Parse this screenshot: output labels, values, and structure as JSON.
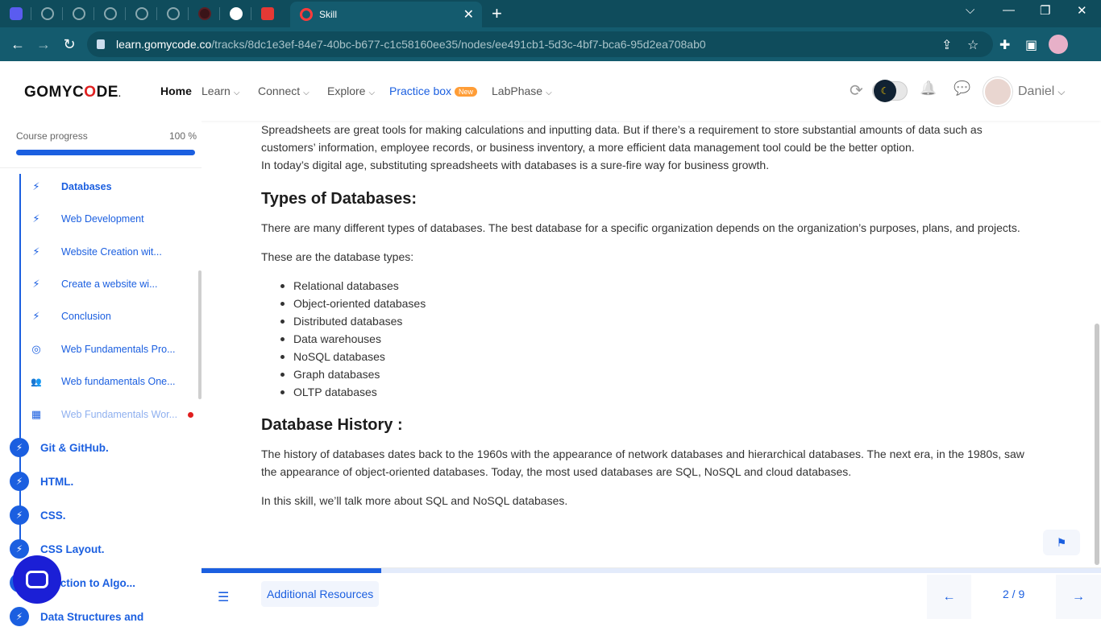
{
  "browser": {
    "active_tab_title": "Skill",
    "close_glyph": "✕",
    "new_tab_glyph": "+",
    "url_host": "learn.gomycode.co",
    "url_path": "/tracks/8dc1e3ef-84e7-40bc-b677-c1c58160ee35/nodes/ee491cb1-5d3c-4bf7-bca6-95d2ea708ab0",
    "back_glyph": "←",
    "forward_glyph": "→",
    "reload_glyph": "↻",
    "minimize_glyph": "—",
    "restore_glyph": "❐",
    "close_window_glyph": "✕",
    "share_glyph": "⇪",
    "star_glyph": "☆",
    "extensions_glyph": "✚",
    "sidepanel_glyph": "▣"
  },
  "header": {
    "logo_pre": "GOMYC",
    "logo_o": "O",
    "logo_post": "DE",
    "logo_mark": ".",
    "nav": {
      "home": "Home",
      "learn": "Learn",
      "connect": "Connect",
      "explore": "Explore",
      "practice": "Practice box",
      "practice_badge": "New",
      "labphase": "LabPhase"
    },
    "chevron": "⌵",
    "sync_glyph": "⟳",
    "moon_glyph": "☾",
    "bell_glyph": "🔔",
    "chat_glyph": "💬",
    "user_name": "Daniel"
  },
  "sidebar": {
    "progress_label": "Course progress",
    "progress_value": "100 %",
    "progress_fraction": 1.0,
    "items": [
      {
        "label": "Databases",
        "icon": "bolt-icon",
        "glyph": "⚡"
      },
      {
        "label": "Web Development",
        "icon": "bolt-icon",
        "glyph": "⚡"
      },
      {
        "label": "Website Creation wit...",
        "icon": "bolt-icon",
        "glyph": "⚡"
      },
      {
        "label": "Create a website wi...",
        "icon": "bolt-icon",
        "glyph": "⚡"
      },
      {
        "label": "Conclusion",
        "icon": "bolt-icon",
        "glyph": "⚡"
      },
      {
        "label": "Web Fundamentals Pro...",
        "icon": "target-icon",
        "glyph": "◎"
      },
      {
        "label": "Web fundamentals One...",
        "icon": "people-icon",
        "glyph": "👥"
      },
      {
        "label": "Web Fundamentals Wor...",
        "icon": "workshop-icon",
        "glyph": "▦"
      }
    ],
    "sections": [
      {
        "label": "Git & GitHub.",
        "glyph": "⚡"
      },
      {
        "label": "HTML.",
        "glyph": "⚡"
      },
      {
        "label": "CSS.",
        "glyph": "⚡"
      },
      {
        "label": "CSS Layout.",
        "glyph": "⚡"
      },
      {
        "label": "oduction to Algo...",
        "glyph": "⚡"
      },
      {
        "label": "Data Structures and",
        "glyph": "⚡"
      }
    ]
  },
  "content": {
    "intro_p1": "Spreadsheets are great tools for making calculations and inputting data. But if there’s a requirement to store substantial amounts of data such as customers’ information, employee records, or business inventory, a more efficient data management tool could be the better option.",
    "intro_p2": "In today’s digital age, substituting spreadsheets with databases is a sure-fire way for business growth.",
    "types_heading": "Types of Databases:",
    "types_p": "There are many different types of databases. The best database for a specific organization depends on the organization’s purposes, plans, and projects.",
    "types_intro": "These are the database types:",
    "types_list": [
      "Relational databases",
      "Object-oriented databases",
      "Distributed databases",
      "Data warehouses",
      "NoSQL databases",
      "Graph databases",
      "OLTP databases"
    ],
    "history_heading": "Database History :",
    "history_p": "The history of databases dates back to the 1960s with the appearance of network databases and hierarchical databases. The next era, in the 1980s, saw the appearance of object-oriented databases. Today, the most used databases are SQL, NoSQL and cloud databases.",
    "closing_p": "In this skill, we’ll talk more about SQL and NoSQL databases."
  },
  "footer": {
    "additional_resources": "Additional Resources",
    "page_indicator": "2 / 9",
    "lesson_progress_fraction": 0.2,
    "toc_glyph": "☰",
    "prev_glyph": "←",
    "next_glyph": "→",
    "flag_glyph": "⚑"
  },
  "colors": {
    "accent": "#1b5fe0",
    "browser_frame": "#145b6e",
    "new_badge": "#ff9d37",
    "alert_dot": "#e01e1e"
  }
}
